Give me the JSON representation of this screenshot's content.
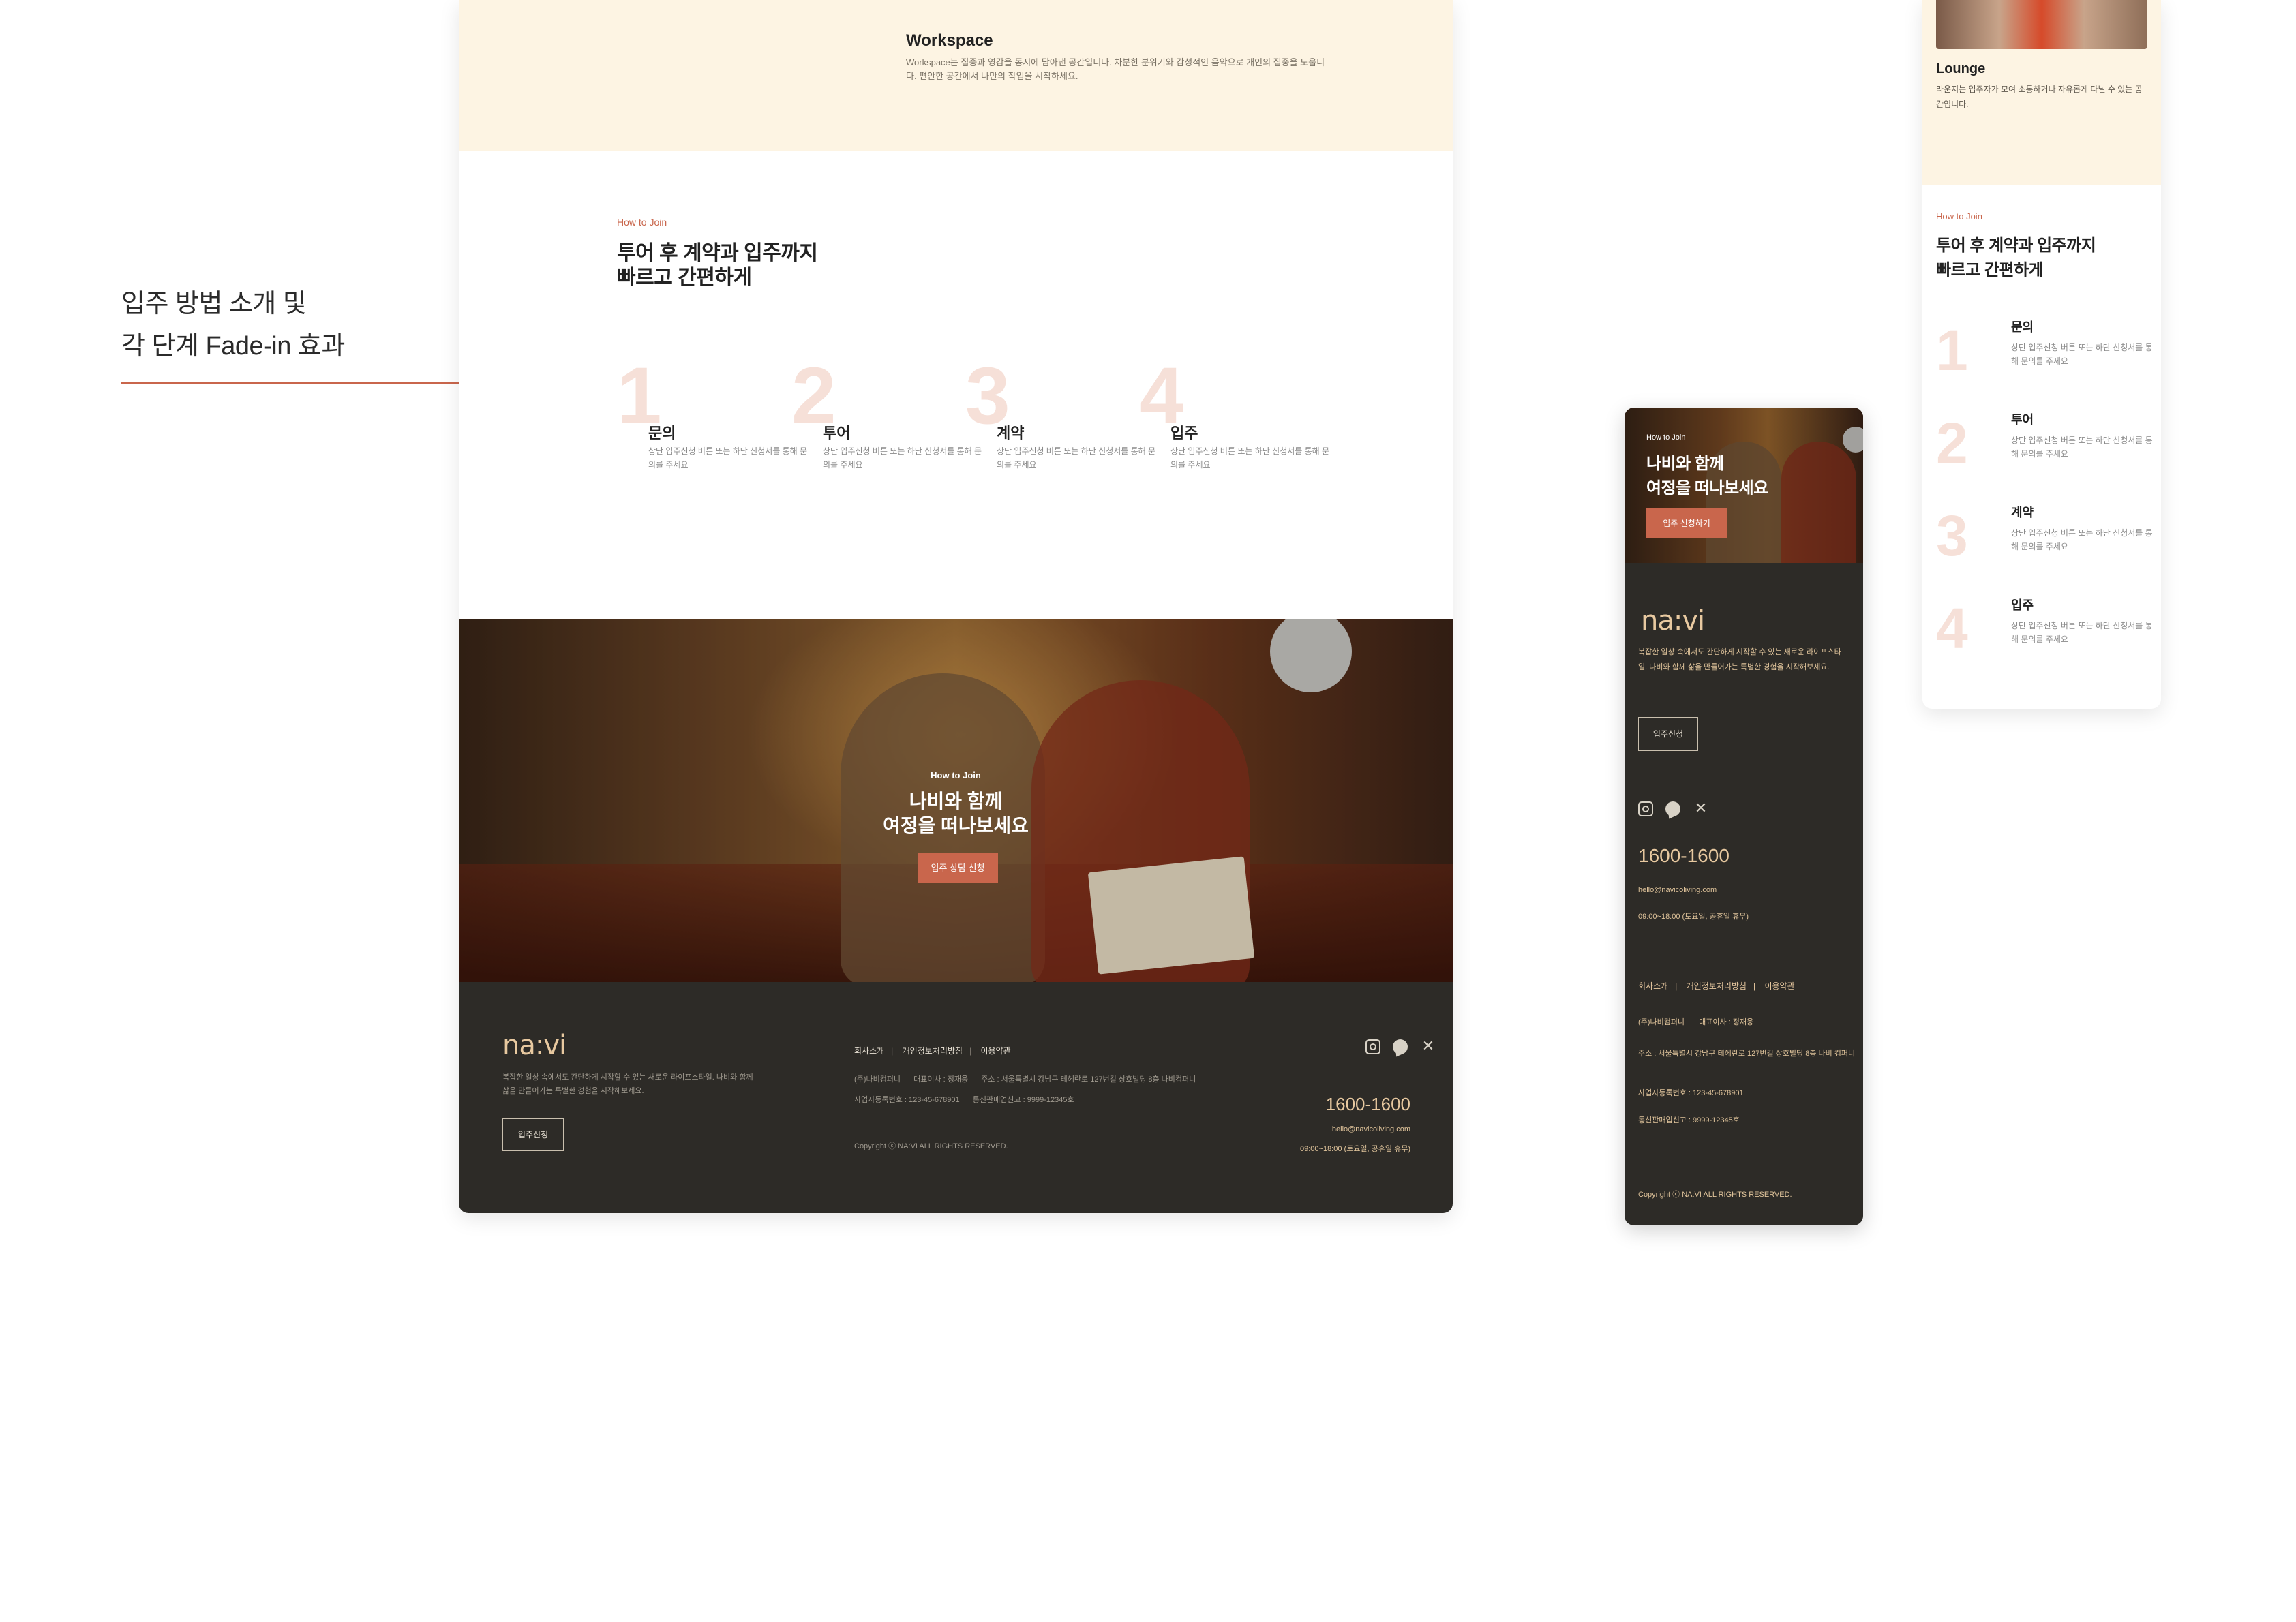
{
  "annotation": {
    "line1": "입주 방법 소개 및",
    "line2": "각 단계 Fade-in 효과"
  },
  "desktop": {
    "workspace": {
      "title": "Workspace",
      "desc": "Workspace는 집중과 영감을 동시에 담아낸 공간입니다. 차분한 분위기와 감성적인 음악으로 개인의 집중을 도웁니다. 편안한 공간에서 나만의 작업을 시작하세요."
    },
    "join": {
      "eyebrow": "How to Join",
      "heading_line1": "투어 후 계약과 입주까지",
      "heading_line2": "빠르고 간편하게",
      "steps": [
        {
          "num": "1",
          "title": "문의",
          "desc": "상단 입주신청 버튼 또는 하단 신청서를 통해 문의를 주세요"
        },
        {
          "num": "2",
          "title": "투어",
          "desc": "상단 입주신청 버튼 또는 하단 신청서를 통해 문의를 주세요"
        },
        {
          "num": "3",
          "title": "계약",
          "desc": "상단 입주신청 버튼 또는 하단 신청서를 통해 문의를 주세요"
        },
        {
          "num": "4",
          "title": "입주",
          "desc": "상단 입주신청 버튼 또는 하단 신청서를 통해 문의를 주세요"
        }
      ]
    },
    "hero": {
      "eyebrow": "How to Join",
      "title_line1": "나비와 함께",
      "title_line2": "여정을 떠나보세요",
      "cta": "입주 상담 신청"
    },
    "footer": {
      "logo": "na:vi",
      "desc": "복잡한 일상 속에서도 간단하게 시작할 수 있는 새로운 라이프스타일. 나비와 함께 삶을 만들어가는 특별한 경험을 시작해보세요.",
      "apply": "입주신청",
      "links": [
        "회사소개",
        "개인정보처리방침",
        "이용약관"
      ],
      "company": "(주)나비컴퍼니",
      "ceo": "대표이사 : 정재웅",
      "address": "주소 : 서울특별시 강남구 테헤란로 127번길 상호빌딩 8층 나비컴퍼니",
      "biz_no": "사업자등록번호 : 123-45-678901",
      "sales_no": "통신판매업신고 : 9999-12345호",
      "copyright": "Copyright ⓒ NA:VI ALL RIGHTS RESERVED.",
      "phone": "1600-1600",
      "email": "hello@navicoliving.com",
      "hours": "09:00~18:00 (토요일, 공휴일 휴무)"
    }
  },
  "mobile": {
    "hero": {
      "eyebrow": "How to Join",
      "title_line1": "나비와 함께",
      "title_line2": "여정을 떠나보세요",
      "cta": "입주 신청하기"
    },
    "footer": {
      "logo": "na:vi",
      "desc": "복잡한 일상 속에서도 간단하게 시작할 수 있는 새로운 라이프스타일. 나비와 함께 삶을 만들어가는 특별한 경험을 시작해보세요.",
      "apply": "입주신청",
      "phone": "1600-1600",
      "email": "hello@navicoliving.com",
      "hours": "09:00~18:00 (토요일, 공휴일 휴무)",
      "links": [
        "회사소개",
        "개인정보처리방침",
        "이용약관"
      ],
      "company": "(주)나비컴퍼니",
      "ceo": "대표이사 : 정재웅",
      "address": "주소 : 서울특별시 강남구 테헤란로 127번길 상호빌딩 8층 나비 컴퍼니",
      "biz_no": "사업자등록번호 : 123-45-678901",
      "sales_no": "통신판매업신고 : 9999-12345호",
      "copyright": "Copyright ⓒ NA:VI ALL RIGHTS RESERVED."
    }
  },
  "panel": {
    "lounge": {
      "title": "Lounge",
      "desc": "라운지는 입주자가 모여 소통하거나 자유롭게 다닐 수 있는 공간입니다."
    },
    "join": {
      "eyebrow": "How to Join",
      "heading_line1": "투어 후 계약과 입주까지",
      "heading_line2": "빠르고 간편하게",
      "steps": [
        {
          "num": "1",
          "title": "문의",
          "desc": "상단 입주신청 버튼 또는 하단 신청서를 통해 문의를 주세요"
        },
        {
          "num": "2",
          "title": "투어",
          "desc": "상단 입주신청 버튼 또는 하단 신청서를 통해 문의를 주세요"
        },
        {
          "num": "3",
          "title": "계약",
          "desc": "상단 입주신청 버튼 또는 하단 신청서를 통해 문의를 주세요"
        },
        {
          "num": "4",
          "title": "입주",
          "desc": "상단 입주신청 버튼 또는 하단 신청서를 통해 문의를 주세요"
        }
      ]
    }
  },
  "colors": {
    "accent": "#c9664c",
    "cream": "#fdf4e3",
    "footer_bg": "#2d2b27",
    "gold": "#e8c9a0",
    "step_number": "#f6e0d8"
  },
  "icons": [
    "instagram-icon",
    "chat-icon",
    "x-icon"
  ]
}
